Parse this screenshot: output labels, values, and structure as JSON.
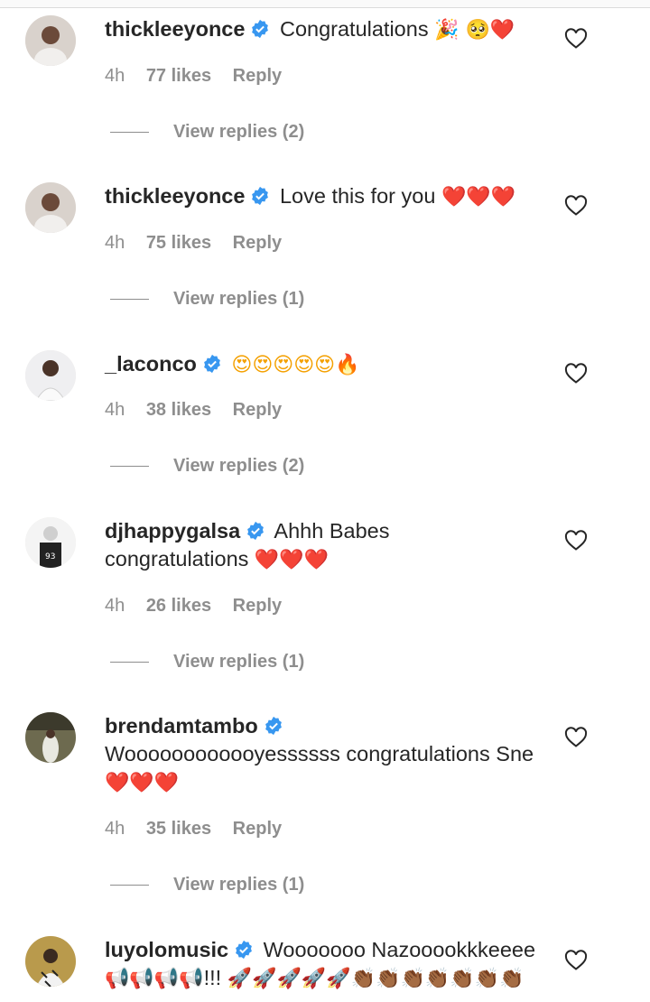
{
  "comments": [
    {
      "username": "thickleeyonce",
      "text": "Congratulations",
      "emojis": "🎉 🥺❤️",
      "time": "4h",
      "likes": "77 likes",
      "reply": "Reply",
      "view_replies": "View replies (2)"
    },
    {
      "username": "thickleeyonce",
      "text": "Love this for you",
      "emojis": "❤️❤️❤️",
      "time": "4h",
      "likes": "75 likes",
      "reply": "Reply",
      "view_replies": "View replies (1)"
    },
    {
      "username": "_laconco",
      "text": "",
      "emojis": "😍😍😍😍😍🔥",
      "time": "4h",
      "likes": "38 likes",
      "reply": "Reply",
      "view_replies": "View replies (2)"
    },
    {
      "username": "djhappygalsa",
      "text": "Ahhh Babes congratulations",
      "emojis": "❤️❤️❤️",
      "time": "4h",
      "likes": "26 likes",
      "reply": "Reply",
      "view_replies": "View replies (1)"
    },
    {
      "username": "brendamtambo",
      "text": "Woooooooooooyessssss congratulations Sne",
      "emojis": "❤️❤️❤️",
      "time": "4h",
      "likes": "35 likes",
      "reply": "Reply",
      "view_replies": "View replies (1)"
    },
    {
      "username": "luyolomusic",
      "text": "Wooooooo Nazooookkkeeee",
      "emojis_line2_a": "📢📢📢📢",
      "exclaim": "!!!",
      "emojis_line2_b": "🚀🚀🚀🚀🚀👏🏾👏🏾👏🏾👏🏾👏🏾👏🏾👏🏾"
    }
  ],
  "icons": {
    "verified": "verified-badge-icon",
    "like": "heart-outline-icon"
  },
  "colors": {
    "verified": "#3897f0",
    "muted": "#8e8e8e",
    "text": "#262626"
  }
}
